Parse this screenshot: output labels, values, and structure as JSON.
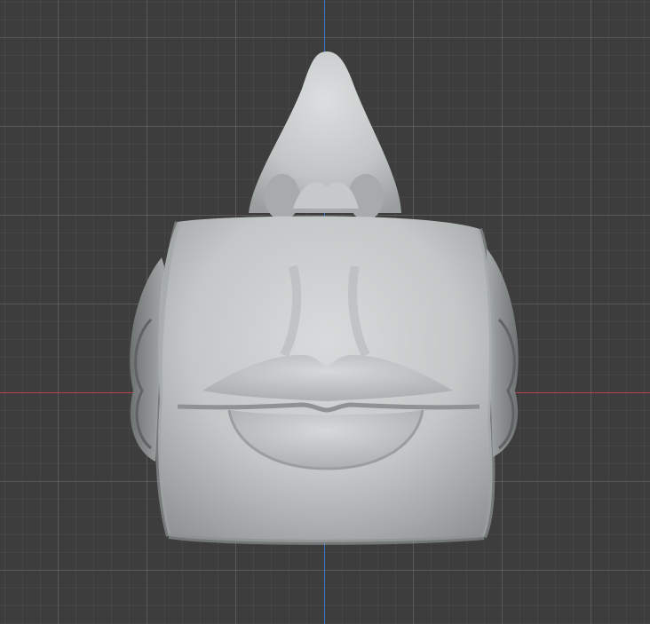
{
  "viewport": {
    "grid_color": "#4a4a4a",
    "background_color": "#3d3d3d",
    "axis_x_color": "#b5434d",
    "axis_y_color": "#3d73c4"
  },
  "model": {
    "icon": "sculpt-mesh-icon",
    "color": "#c9cccc"
  }
}
